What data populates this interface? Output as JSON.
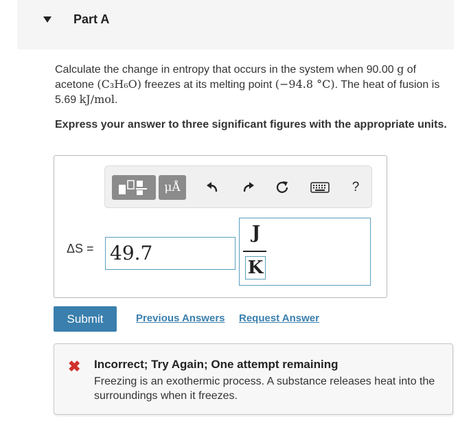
{
  "part": {
    "title": "Part A"
  },
  "question": {
    "text_1": "Calculate the change in entropy that occurs in the system when 90.00 ",
    "mass_unit": "g",
    "text_2": " of acetone ",
    "formula": "(C₃H₆O)",
    "text_3": " freezes at its melting point ",
    "temperature": "(−94.8 °C)",
    "text_4": ". The heat of fusion is 5.69 ",
    "fusion_unit": "kJ/mol",
    "text_5": "."
  },
  "instruction": "Express your answer to three significant figures with the appropriate units.",
  "toolbar": {
    "units_label": "μÅ",
    "undo_icon": "undo-icon",
    "redo_icon": "redo-icon",
    "reset_icon": "reset-icon",
    "keyboard_icon": "keyboard-icon",
    "help_label": "?"
  },
  "answer": {
    "variable_label": "ΔS =",
    "value": "49.7",
    "unit_numerator": "J",
    "unit_denominator": "K"
  },
  "actions": {
    "submit_label": "Submit",
    "previous_answers_label": "Previous Answers",
    "request_answer_label": "Request Answer"
  },
  "feedback": {
    "icon": "x-icon",
    "title": "Incorrect; Try Again; One attempt remaining",
    "message": "Freezing is an exothermic process. A substance releases heat into the surroundings when it freezes."
  },
  "colors": {
    "header_bg": "#f5f5f5",
    "accent": "#3a7fad",
    "field_border": "#5a9fbd",
    "error": "#d0312d"
  }
}
